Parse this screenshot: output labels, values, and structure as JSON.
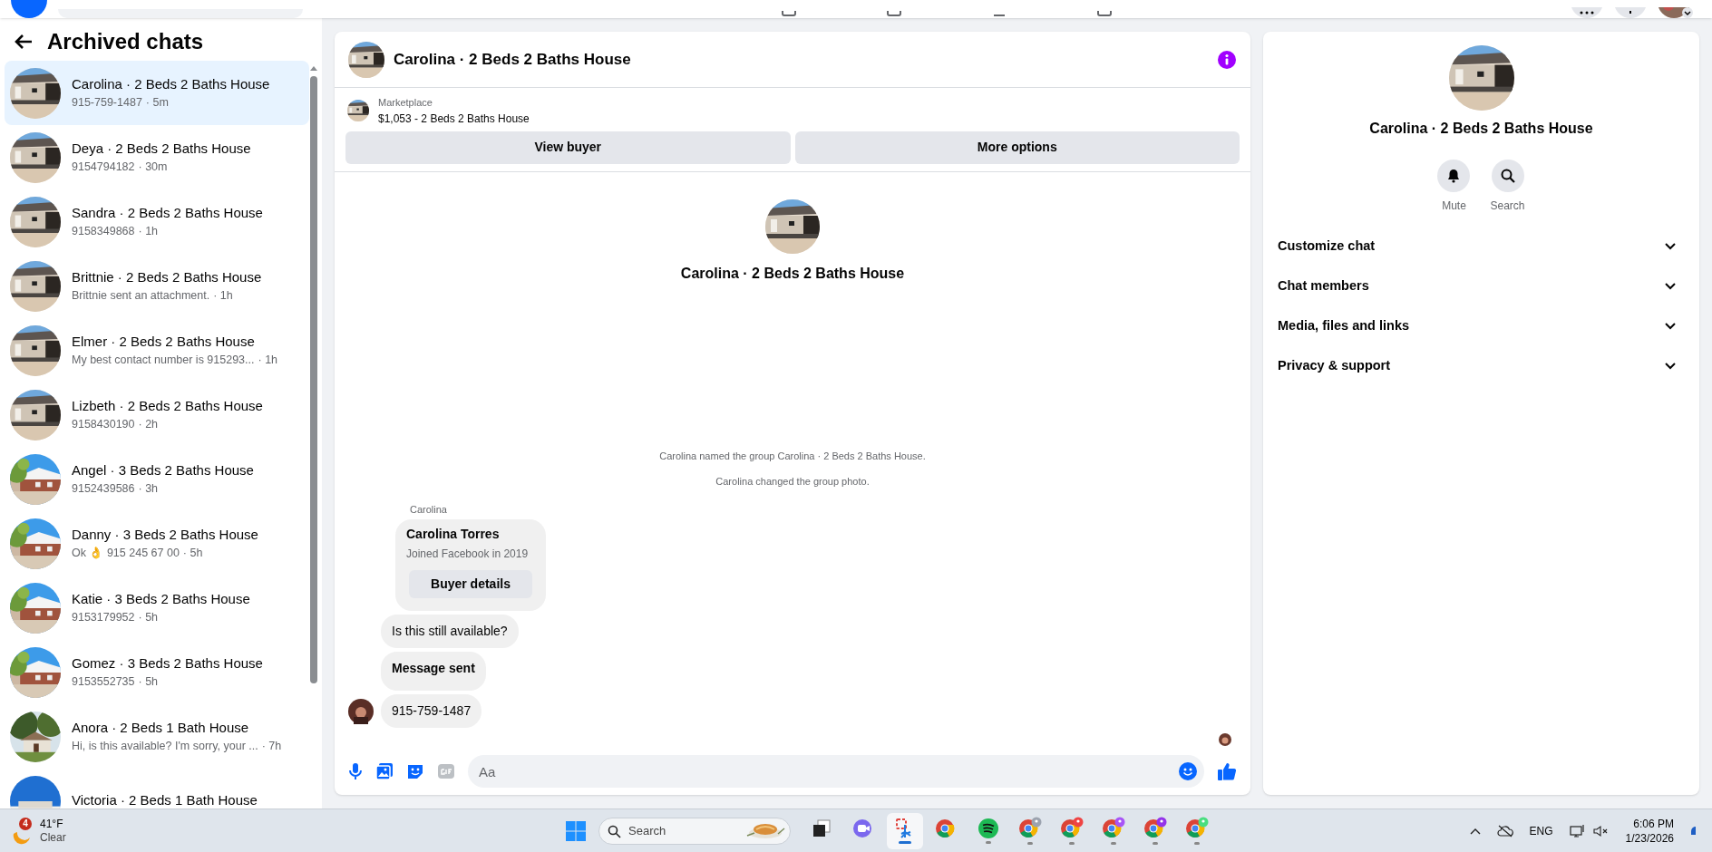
{
  "sidebar": {
    "title": "Archived chats",
    "threads": [
      {
        "name": "Carolina · 2 Beds 2 Baths House",
        "preview": "915-759-1487",
        "time": "· 5m",
        "selected": true
      },
      {
        "name": "Deya · 2 Beds 2 Baths House",
        "preview": "9154794182",
        "time": "· 30m",
        "selected": false
      },
      {
        "name": "Sandra · 2 Beds 2 Baths House",
        "preview": "9158349868",
        "time": "· 1h",
        "selected": false
      },
      {
        "name": "Brittnie · 2 Beds 2 Baths House",
        "preview": "Brittnie sent an attachment.",
        "time": "· 1h",
        "selected": false
      },
      {
        "name": "Elmer · 2 Beds 2 Baths House",
        "preview": "My best contact number is 915293...",
        "time": "· 1h",
        "selected": false
      },
      {
        "name": "Lizbeth · 2 Beds 2 Baths House",
        "preview": "9158430190",
        "time": "· 2h",
        "selected": false
      },
      {
        "name": "Angel · 3 Beds 2 Baths House",
        "preview": "9152439586",
        "time": "· 3h",
        "selected": false
      },
      {
        "name": "Danny · 3 Beds 2 Baths House",
        "preview": "Ok 👌 915 245 67 00",
        "time": "· 5h",
        "selected": false
      },
      {
        "name": "Katie · 3 Beds 2 Baths House",
        "preview": "9153179952",
        "time": "· 5h",
        "selected": false
      },
      {
        "name": "Gomez · 3 Beds 2 Baths House",
        "preview": "9153552735",
        "time": "· 5h",
        "selected": false
      },
      {
        "name": "Anora · 2 Beds 1 Bath House",
        "preview": "Hi, is this available? I'm sorry, your ...",
        "time": "· 7h",
        "selected": false
      },
      {
        "name": "Victoria · 2 Beds 1 Bath House",
        "selected": false
      }
    ]
  },
  "chat": {
    "title": "Carolina · 2 Beds 2 Baths House",
    "listing": {
      "label": "Marketplace",
      "description": "$1,053 - 2 Beds 2 Baths House"
    },
    "actions": [
      "View buyer",
      "More options"
    ],
    "group_title": "Carolina · 2 Beds 2 Baths House",
    "events": [
      "Carolina named the group Carolina · 2 Beds 2 Baths House.",
      "Carolina changed the group photo."
    ],
    "sender": "Carolina",
    "buyer_card": {
      "name": "Carolina Torres",
      "subtitle": "Joined Facebook in 2019",
      "button": "Buyer details"
    },
    "messages": [
      {
        "text": "Is this still available?",
        "bold": false,
        "show_avatar": false
      },
      {
        "text": "Message sent",
        "bold": true,
        "show_avatar": false
      },
      {
        "text": "915-759-1487",
        "bold": false,
        "show_avatar": true
      }
    ],
    "composer": {
      "placeholder": "Aa"
    }
  },
  "details": {
    "title": "Carolina · 2 Beds 2 Baths House",
    "actions": [
      {
        "label": "Mute",
        "kind": "mute"
      },
      {
        "label": "Search",
        "kind": "search"
      }
    ],
    "sections": [
      {
        "label": "Customize chat",
        "expanded": false
      },
      {
        "label": "Chat members",
        "expanded": false
      },
      {
        "label": "Media, files and links",
        "expanded": false
      },
      {
        "label": "Privacy & support",
        "expanded": false
      }
    ]
  },
  "taskbar": {
    "weather": {
      "badge": "4",
      "temperature": "41°F",
      "condition": "Clear"
    },
    "search": {
      "placeholder": "Search"
    },
    "apps": [
      {
        "kind": "task-view",
        "selected": false,
        "running": false
      },
      {
        "kind": "video-chat",
        "selected": false,
        "running": false
      },
      {
        "kind": "snip",
        "selected": true,
        "running": true
      },
      {
        "kind": "chrome",
        "selected": false,
        "running": false
      },
      {
        "kind": "music",
        "selected": false,
        "running": true
      },
      {
        "kind": "chrome",
        "color": "#9ca3af",
        "selected": false,
        "running": true
      },
      {
        "kind": "chrome",
        "color": "#ef4444",
        "selected": false,
        "running": true
      },
      {
        "kind": "chrome",
        "color": "#a855f7",
        "selected": false,
        "running": true
      },
      {
        "kind": "chrome",
        "color": "#9333ea",
        "selected": false,
        "running": true
      },
      {
        "kind": "chrome",
        "color": "#4ade80",
        "selected": false,
        "running": true
      }
    ],
    "language": "ENG",
    "time": "6:06 PM",
    "date": "1/23/2026"
  }
}
